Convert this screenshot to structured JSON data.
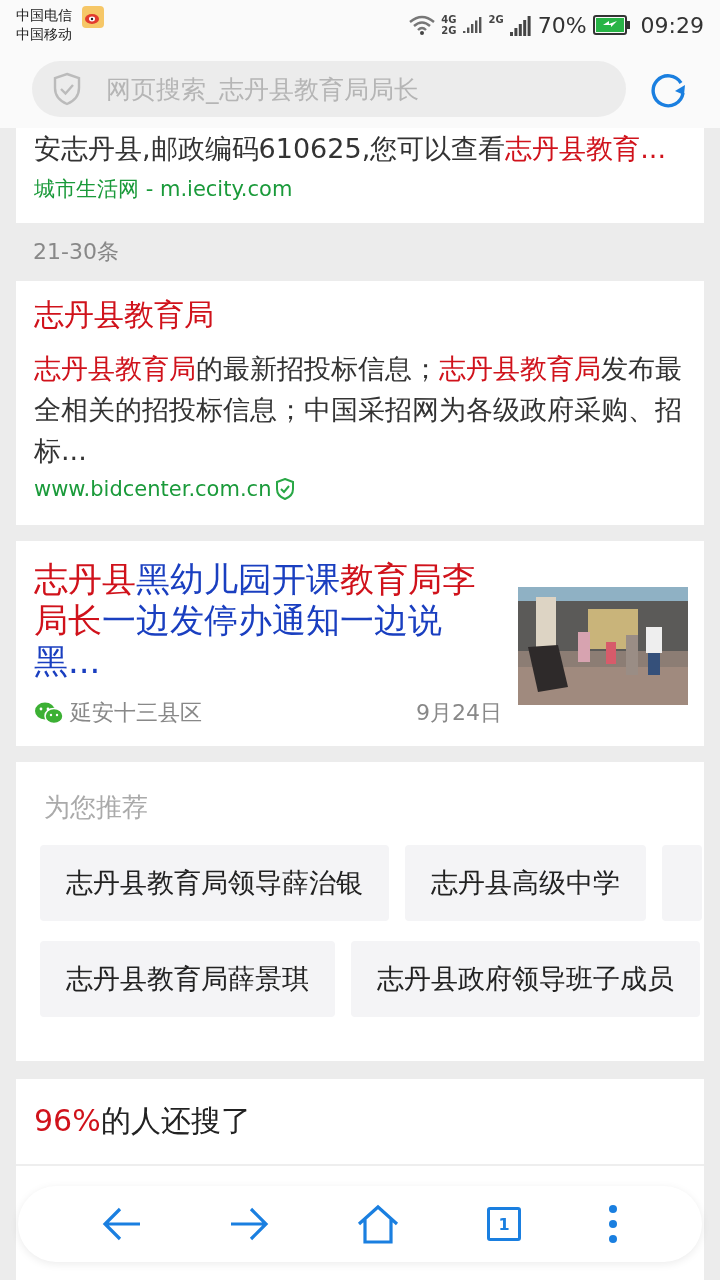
{
  "status_bar": {
    "carriers": [
      "中国电信",
      "中国移动"
    ],
    "network_1": "4G",
    "network_2": "2G",
    "network_3": "2G",
    "battery": "70%",
    "time": "09:29"
  },
  "search": {
    "placeholder": "网页搜索_志丹县教育局局长"
  },
  "results": [
    {
      "kind": "snippet",
      "text": [
        {
          "text": "安志丹县,邮政编码610625,您可以查看",
          "highlight": false
        },
        {
          "text": "志丹县教育...",
          "highlight": true
        }
      ],
      "source": "城市生活网 - m.iecity.com"
    },
    {
      "kind": "divider",
      "label": "21-30条"
    },
    {
      "kind": "full",
      "title": "志丹县教育局",
      "text": [
        {
          "text": "志丹县教育局",
          "highlight": true
        },
        {
          "text": "的最新招投标信息；",
          "highlight": false
        },
        {
          "text": "志丹县教育局",
          "highlight": true
        },
        {
          "text": "发布最全相关的招投标信息；中国采招网为各级政府采购、招标...",
          "highlight": false
        }
      ],
      "url": "www.bidcenter.com.cn",
      "verified": true
    },
    {
      "kind": "news",
      "title": [
        {
          "text": "志丹县",
          "highlight": true
        },
        {
          "text": "黑幼儿园开课",
          "highlight": false
        },
        {
          "text": "教育局李局长",
          "highlight": true
        },
        {
          "text": "一边发停办通知一边说黑...",
          "highlight": false
        }
      ],
      "source": "延安十三县区",
      "date": "9月24日"
    }
  ],
  "recommend": {
    "title": "为您推荐",
    "rows": [
      [
        "志丹县教育局领导薛治银",
        "志丹县高级中学",
        ""
      ],
      [
        "志丹县教育局薛景琪",
        "志丹县政府领导班子成员"
      ]
    ]
  },
  "also_searched": {
    "percent": "96%",
    "title": "的人还搜了"
  },
  "bottom_nav": {
    "tab_count": "1"
  }
}
